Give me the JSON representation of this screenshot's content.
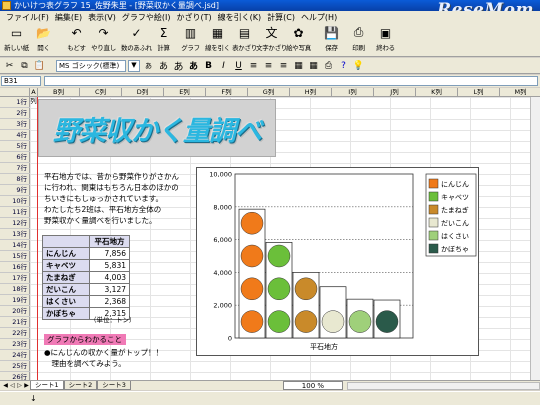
{
  "window": {
    "title": "かいけつ表グラフ 15_佐野朱里 - [野菜収かく量調べ.jsd]",
    "logo": "ReseMom"
  },
  "menu": [
    "ファイル(F)",
    "編集(E)",
    "表示(V)",
    "グラフや絵(I)",
    "かざり(T)",
    "線を引く(K)",
    "計算(C)",
    "ヘルプ(H)"
  ],
  "toolbar": [
    {
      "label": "新しい紙",
      "icon": "new-page-icon",
      "glyph": "▭"
    },
    {
      "label": "開く",
      "icon": "open-folder-icon",
      "glyph": "📂"
    },
    {
      "label": "もどす",
      "icon": "undo-icon",
      "glyph": "↶"
    },
    {
      "label": "やり直し",
      "icon": "redo-icon",
      "glyph": "↷"
    },
    {
      "label": "数のあふれ",
      "icon": "number-overflow-icon",
      "glyph": "✓"
    },
    {
      "label": "計算",
      "icon": "calculate-icon",
      "glyph": "Σ"
    },
    {
      "label": "グラフ",
      "icon": "chart-icon",
      "glyph": "▥"
    },
    {
      "label": "線を引く",
      "icon": "draw-line-icon",
      "glyph": "▦"
    },
    {
      "label": "表かざり",
      "icon": "table-decor-icon",
      "glyph": "▤"
    },
    {
      "label": "文字かざり",
      "icon": "text-decor-icon",
      "glyph": "文"
    },
    {
      "label": "絵や写真",
      "icon": "picture-icon",
      "glyph": "✿"
    },
    {
      "label": "保存",
      "icon": "save-icon",
      "glyph": "💾"
    },
    {
      "label": "印刷",
      "icon": "print-icon",
      "glyph": "⎙"
    },
    {
      "label": "終わる",
      "icon": "exit-icon",
      "glyph": "▣"
    }
  ],
  "format": {
    "font": "MS ゴシック(標準)",
    "size": "▼",
    "glyphs_a": [
      "✂",
      "⧉",
      "📋"
    ],
    "glyphs_b": [
      "あ",
      "あ",
      "あ",
      "あ"
    ],
    "glyphs_c": [
      "B",
      "I",
      "U",
      "≡",
      "≡",
      "≡",
      "▦",
      "▦",
      "⎙",
      "?",
      "💡"
    ]
  },
  "formula": {
    "cell_ref": "B31",
    "value": ""
  },
  "columns": [
    "A列",
    "B列",
    "C列",
    "D列",
    "E列",
    "F列",
    "G列",
    "H列",
    "I列",
    "J列",
    "K列",
    "L列",
    "M列"
  ],
  "rows": [
    "1行",
    "2行",
    "3行",
    "4行",
    "5行",
    "6行",
    "7行",
    "8行",
    "9行",
    "10行",
    "11行",
    "12行",
    "13行",
    "14行",
    "15行",
    "16行",
    "17行",
    "18行",
    "19行",
    "20行",
    "21行",
    "22行",
    "23行",
    "24行",
    "25行",
    "26行"
  ],
  "sheet": {
    "banner": "野菜収かく量調べ",
    "description": [
      "平石地方では、昔から野菜作りがさかん",
      "に行われ、関東はもちろん日本のほかの",
      "ちいきにもしゅっかされています。",
      "わたしたち2班は、平石地方全体の",
      "野菜収かく量調べを行いました。"
    ],
    "table_header": "平石地方",
    "table_rows": [
      {
        "name": "にんじん",
        "value": "7,856"
      },
      {
        "name": "キャベツ",
        "value": "5,831"
      },
      {
        "name": "たまねぎ",
        "value": "4,003"
      },
      {
        "name": "だいこん",
        "value": "3,127"
      },
      {
        "name": "はくさい",
        "value": "2,368"
      },
      {
        "name": "かぼちゃ",
        "value": "2,315"
      }
    ],
    "unit": "（単位：トン）",
    "graph_heading": "グラフからわかること",
    "graph_notes": [
      "●にんじんの収かく量がトップ！！",
      "　理由を調べてみよう。"
    ]
  },
  "chart_data": {
    "type": "bar",
    "categories": [
      "平石地方"
    ],
    "series": [
      {
        "name": "にんじん",
        "values": [
          7856
        ],
        "color": "#f07a1a"
      },
      {
        "name": "キャベツ",
        "values": [
          5831
        ],
        "color": "#6bbf3a"
      },
      {
        "name": "たまねぎ",
        "values": [
          4003
        ],
        "color": "#c98a2a"
      },
      {
        "name": "だいこん",
        "values": [
          3127
        ],
        "color": "#e8e8d0"
      },
      {
        "name": "はくさい",
        "values": [
          2368
        ],
        "color": "#9fd07a"
      },
      {
        "name": "かぼちゃ",
        "values": [
          2315
        ],
        "color": "#2a5a4a"
      }
    ],
    "y_ticks": [
      "0",
      "2,000",
      "4,000",
      "6,000",
      "8,000",
      "10,000"
    ],
    "ylim": [
      0,
      10000
    ],
    "xlabel": "平石地方",
    "legend_position": "right",
    "grid": true
  },
  "tabs": [
    "シート1",
    "シート2",
    "シート3"
  ],
  "zoom": "100 %",
  "status": "↓"
}
